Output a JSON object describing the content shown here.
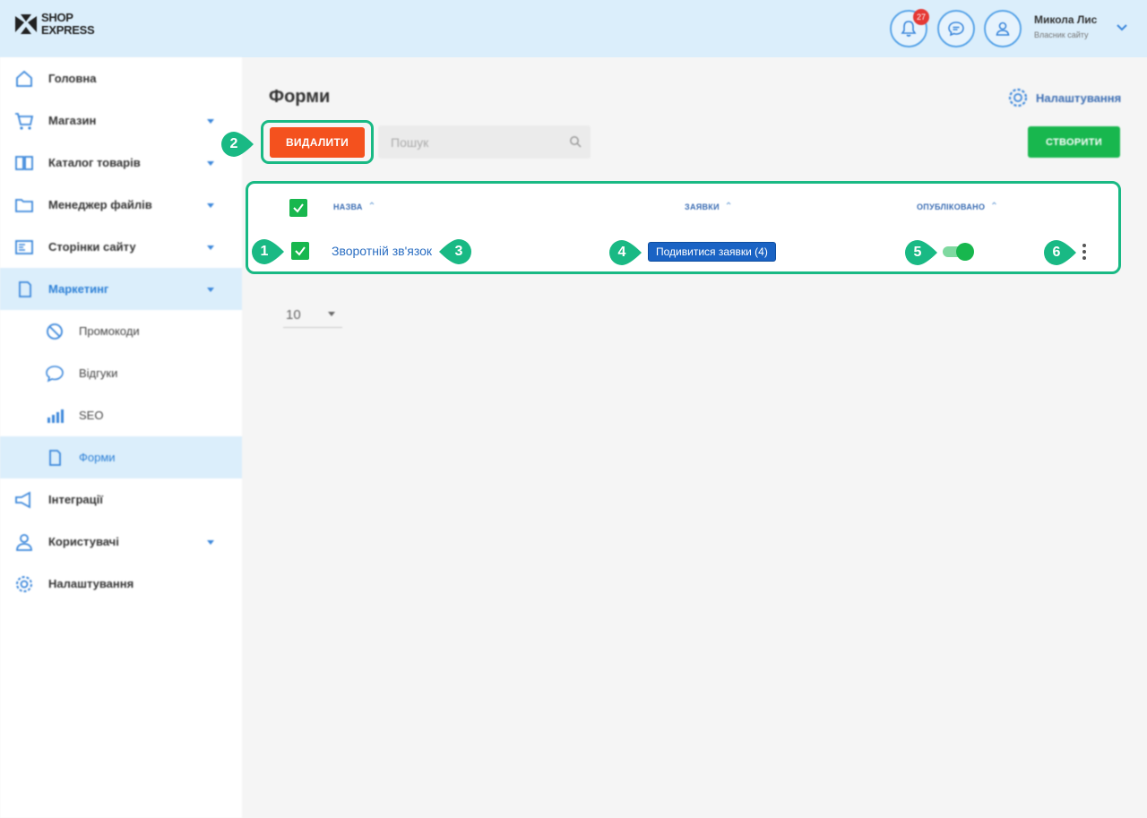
{
  "header": {
    "logo_line1": "SHOP",
    "logo_line2": "EXPRESS",
    "notifications_count": "27",
    "user_name": "Микола Лис",
    "user_role": "Власник сайту"
  },
  "sidebar": {
    "items": [
      {
        "label": "Головна",
        "icon": "home-icon"
      },
      {
        "label": "Магазин",
        "icon": "cart-icon"
      },
      {
        "label": "Каталог товарів",
        "icon": "catalog-icon"
      },
      {
        "label": "Менеджер файлів",
        "icon": "folder-icon"
      },
      {
        "label": "Сторінки сайту",
        "icon": "pages-icon"
      },
      {
        "label": "Маркетинг",
        "icon": "marketing-icon"
      },
      {
        "label": "Інтеграції",
        "icon": "megaphone-icon"
      },
      {
        "label": "Користувачі",
        "icon": "user-icon"
      },
      {
        "label": "Налаштування",
        "icon": "gear-icon"
      }
    ],
    "subitems": [
      {
        "label": "Промокоди",
        "icon": "promo-icon"
      },
      {
        "label": "Відгуки",
        "icon": "reviews-icon"
      },
      {
        "label": "SEO",
        "icon": "seo-icon"
      },
      {
        "label": "Форми",
        "icon": "forms-icon"
      }
    ]
  },
  "main": {
    "title": "Форми",
    "settings_label": "Налаштування",
    "delete_label": "ВИДАЛИТИ",
    "search_placeholder": "Пошук",
    "create_label": "СТВОРИТИ",
    "columns": [
      "НАЗВА",
      "ЗАЯВКИ",
      "ОПУБЛІКОВАНО"
    ],
    "rows": [
      {
        "name": "Зворотній зв'язок",
        "requests_label": "Подивитися заявки (4)",
        "published": true,
        "selected": true
      }
    ],
    "per_page": "10"
  },
  "markers": [
    "1",
    "2",
    "3",
    "4",
    "5",
    "6"
  ],
  "colors": {
    "header_bg": "#dbeefb",
    "accent_green": "#18b74e",
    "callout": "#19b984",
    "delete_orange": "#f4511e",
    "link_blue": "#2b6ec2"
  }
}
